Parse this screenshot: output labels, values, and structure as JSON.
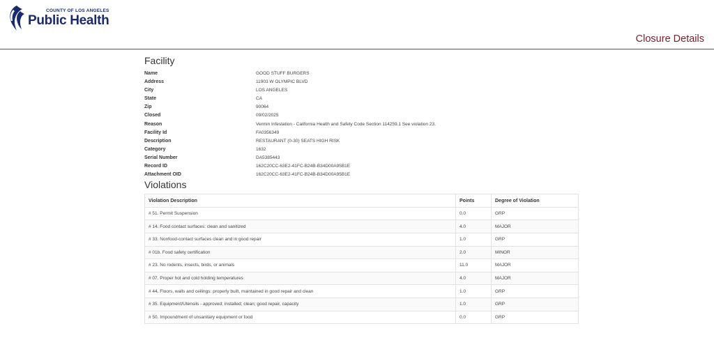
{
  "header": {
    "logo_county": "COUNTY OF LOS ANGELES",
    "logo_title": "Public Health",
    "page_title": "Closure Details"
  },
  "facility": {
    "heading": "Facility",
    "fields": [
      {
        "label": "Name",
        "value": "GOOD STUFF BURGERS"
      },
      {
        "label": "Address",
        "value": "11903 W OLYMPIC BLVD"
      },
      {
        "label": "City",
        "value": "LOS ANGELES"
      },
      {
        "label": "State",
        "value": "CA"
      },
      {
        "label": "Zip",
        "value": "90064"
      },
      {
        "label": "Closed",
        "value": "09/02/2025"
      },
      {
        "label": "Reason",
        "value": "Vermin Infestation - California Health and Safety Code Section 114259.1 See violation 23."
      },
      {
        "label": "Facility Id",
        "value": "FA0356349"
      },
      {
        "label": "Description",
        "value": "RESTAURANT (0-30) SEATS HIGH RISK"
      },
      {
        "label": "Category",
        "value": "1632"
      },
      {
        "label": "Serial Number",
        "value": "DA5385443"
      },
      {
        "label": "Record ID",
        "value": "162C20CC-63E2-41FC-B24B-B34D00A95B1E"
      },
      {
        "label": "Attachment OID",
        "value": "162C20CC-63E2-41FC-B24B-B34D00A95B1E"
      }
    ]
  },
  "violations": {
    "heading": "Violations",
    "columns": [
      "Violation Description",
      "Points",
      "Degree of Violation"
    ],
    "rows": [
      [
        "# 51. Permit Suspension",
        "0.0",
        "GRP"
      ],
      [
        "# 14. Food contact surfaces: clean and sanitized",
        "4.0",
        "MAJOR"
      ],
      [
        "# 33. Nonfood-contact surfaces clean and in good repair",
        "1.0",
        "GRP"
      ],
      [
        "# 01b. Food safety certification",
        "2.0",
        "MINOR"
      ],
      [
        "# 23. No rodents, insects, birds, or animals",
        "11.0",
        "MAJOR"
      ],
      [
        "# 07. Proper hot and cold holding temperatures",
        "4.0",
        "MAJOR"
      ],
      [
        "# 44. Floors, walls and ceilings: properly built, maintained in good repair and clean",
        "1.0",
        "GRP"
      ],
      [
        "# 35. Equipment/Utensils - approved; installed; clean; good repair, capacity",
        "1.0",
        "GRP"
      ],
      [
        "# 50. Impoundment of unsanitary equipment or food",
        "0.0",
        "GRP"
      ]
    ]
  },
  "colors": {
    "brand": "#1b2a6b",
    "title": "#7a1c2a"
  }
}
